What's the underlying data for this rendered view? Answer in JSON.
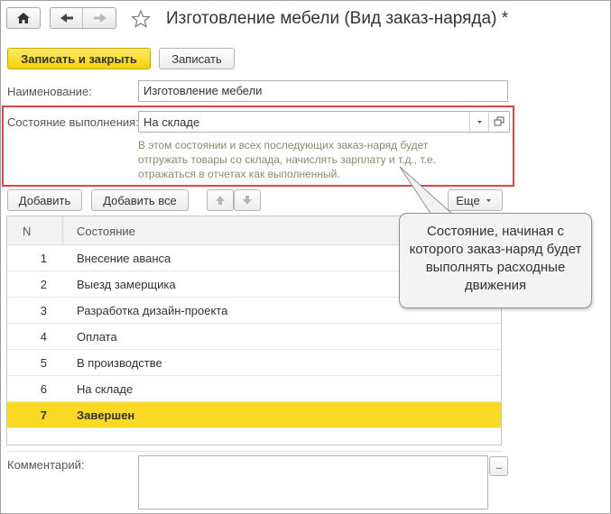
{
  "window": {
    "title": "Изготовление мебели (Вид заказ-наряда) *"
  },
  "toolbar": {
    "save_close_label": "Записать и закрыть",
    "save_label": "Записать"
  },
  "form": {
    "name_label": "Наименование:",
    "name_value": "Изготовление мебели",
    "state_label": "Состояние выполнения:",
    "state_value": "На складе",
    "state_hint": "В этом состоянии и всех последующих заказ-наряд будет отгружать товары со склада, начислять зарплату и т.д., т.е. отражаться в отчетах как выполненный.",
    "comment_label": "Комментарий:",
    "comment_value": ""
  },
  "table_toolbar": {
    "add_label": "Добавить",
    "add_all_label": "Добавить все",
    "more_label": "Еще"
  },
  "table": {
    "headers": [
      "N",
      "Состояние"
    ],
    "rows": [
      {
        "n": "1",
        "state": "Внесение аванса"
      },
      {
        "n": "2",
        "state": "Выезд замерщика"
      },
      {
        "n": "3",
        "state": "Разработка дизайн-проекта"
      },
      {
        "n": "4",
        "state": "Оплата"
      },
      {
        "n": "5",
        "state": "В производстве"
      },
      {
        "n": "6",
        "state": "На складе"
      },
      {
        "n": "7",
        "state": "Завершен"
      }
    ],
    "selected_row": 7
  },
  "callout": {
    "text": "Состояние, начиная с которого заказ-наряд будет выполнять расходные движения"
  },
  "colors": {
    "accent_yellow": "#f9d923",
    "highlight_red": "#e0454c",
    "hint_text": "#8a8a70"
  },
  "icons": [
    "home-icon",
    "back-arrow-icon",
    "forward-arrow-icon",
    "star-icon",
    "dropdown-arrow-icon",
    "open-form-icon",
    "move-up-icon",
    "move-down-icon",
    "ellipsis-icon"
  ]
}
